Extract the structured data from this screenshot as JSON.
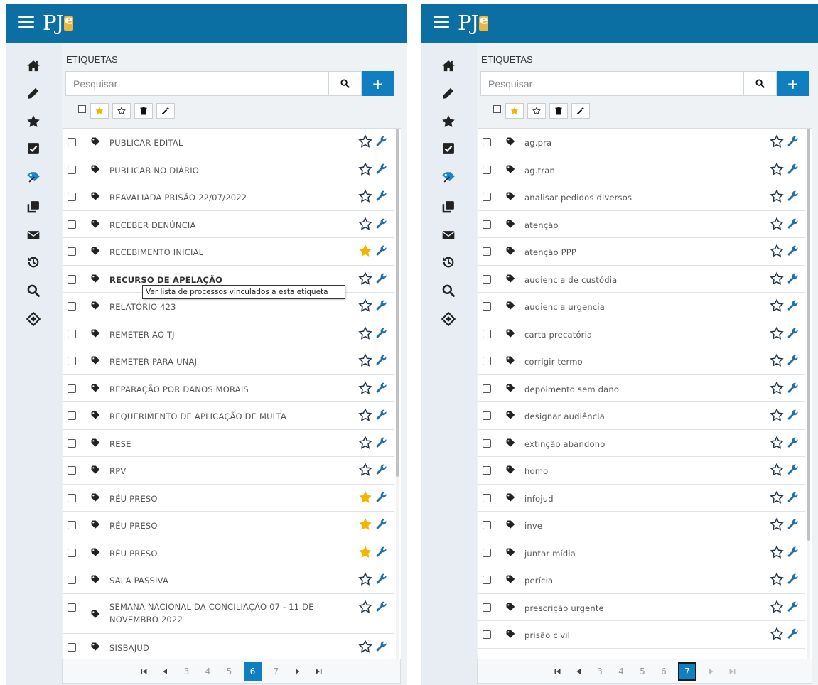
{
  "app": {
    "logo": "PJe",
    "menu_icon": "hamburger-icon"
  },
  "colors": {
    "topbar": "#0b6fa4",
    "accent": "#0f7fc2",
    "star_filled": "#f5b400",
    "sidebar_bg": "#e7edf2"
  },
  "nav": [
    "home-icon",
    "pencil-icon",
    "star-icon",
    "checkbox-icon",
    "tags-icon",
    "copy-icon",
    "envelope-icon",
    "history-icon",
    "search-icon",
    "pje-office-icon"
  ],
  "left": {
    "title": "ETIQUETAS",
    "search_placeholder": "Pesquisar",
    "add_label": "+",
    "items": [
      {
        "label": "PUBLICAR EDITAL",
        "fav": false
      },
      {
        "label": "PUBLICAR NO DIÁRIO",
        "fav": false
      },
      {
        "label": "REAVALIADA PRISÃO 22/07/2022",
        "fav": false
      },
      {
        "label": "RECEBER DENÚNCIA",
        "fav": false
      },
      {
        "label": "RECEBIMENTO INICIAL",
        "fav": true
      },
      {
        "label": "RECURSO DE APELAÇÃO",
        "fav": false
      },
      {
        "label": "RELATÓRIO 423",
        "fav": false
      },
      {
        "label": "REMETER AO TJ",
        "fav": false
      },
      {
        "label": "REMETER PARA UNAJ",
        "fav": false
      },
      {
        "label": "REPARAÇÃO POR DANOS MORAIS",
        "fav": false
      },
      {
        "label": "REQUERIMENTO DE APLICAÇÃO DE MULTA",
        "fav": false
      },
      {
        "label": "RESE",
        "fav": false
      },
      {
        "label": "RPV",
        "fav": false
      },
      {
        "label": "RÉU PRESO",
        "fav": true
      },
      {
        "label": "RÉU PRESO",
        "fav": true
      },
      {
        "label": "RÉU PRESO",
        "fav": true
      },
      {
        "label": "SALA PASSIVA",
        "fav": false
      },
      {
        "label": "SEMANA NACIONAL DA CONCILIAÇÃO 07 - 11 DE NOVEMBRO 2022",
        "fav": false
      },
      {
        "label": "SISBAJUD",
        "fav": false
      }
    ],
    "tooltip": "Ver lista de processos vinculados a esta etiqueta",
    "pages": [
      "3",
      "4",
      "5",
      "6",
      "7"
    ],
    "current_page": "6"
  },
  "right": {
    "title": "ETIQUETAS",
    "search_placeholder": "Pesquisar",
    "add_label": "+",
    "items": [
      {
        "label": "ag.pra",
        "fav": false
      },
      {
        "label": "ag.tran",
        "fav": false
      },
      {
        "label": "analisar pedidos diversos",
        "fav": false
      },
      {
        "label": "atenção",
        "fav": false
      },
      {
        "label": "atenção PPP",
        "fav": false
      },
      {
        "label": "audiencia de custódia",
        "fav": false
      },
      {
        "label": "audiencia urgencia",
        "fav": false
      },
      {
        "label": "carta precatória",
        "fav": false
      },
      {
        "label": "corrigir termo",
        "fav": false
      },
      {
        "label": "depoimento sem dano",
        "fav": false
      },
      {
        "label": "designar audiência",
        "fav": false
      },
      {
        "label": "extinção abandono",
        "fav": false
      },
      {
        "label": "homo",
        "fav": false
      },
      {
        "label": "infojud",
        "fav": false
      },
      {
        "label": "inve",
        "fav": false
      },
      {
        "label": "juntar mídia",
        "fav": false
      },
      {
        "label": "perícia",
        "fav": false
      },
      {
        "label": "prescrição urgente",
        "fav": false
      },
      {
        "label": "prisão civil",
        "fav": false
      }
    ],
    "pages": [
      "3",
      "4",
      "5",
      "6",
      "7"
    ],
    "current_page": "7"
  }
}
